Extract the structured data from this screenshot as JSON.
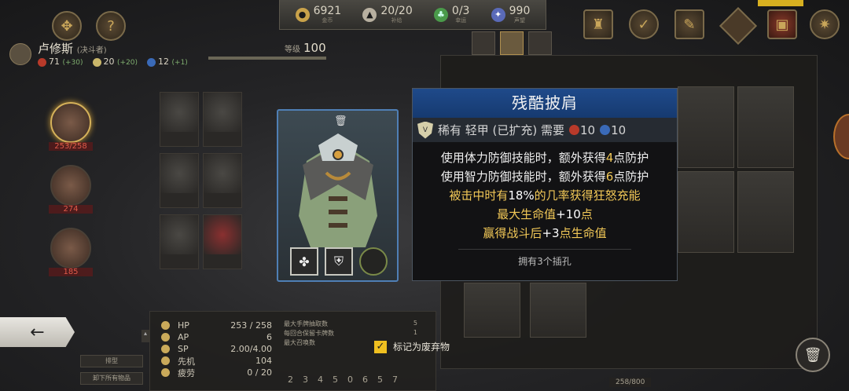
{
  "resources": [
    {
      "icon": "gold-coin-icon",
      "value": "6921",
      "label": "金币",
      "color": "#c9a24a"
    },
    {
      "icon": "provisions-icon",
      "value": "20/20",
      "label": "补给",
      "color": "#b8b0a0"
    },
    {
      "icon": "clover-icon",
      "value": "0/3",
      "label": "幸运",
      "color": "#4a9a4a"
    },
    {
      "icon": "reputation-icon",
      "value": "990",
      "label": "声望",
      "color": "#5a6ab8"
    }
  ],
  "character": {
    "name": "卢修斯",
    "class": "(决斗者)",
    "hp": "71",
    "hp_bonus": "(+30)",
    "armor": "20",
    "armor_bonus": "(+20)",
    "magic": "12",
    "magic_bonus": "(+1)",
    "level_label": "等级",
    "level": "100"
  },
  "party": [
    {
      "hp": "253/258"
    },
    {
      "hp": "274"
    },
    {
      "hp": "185"
    }
  ],
  "tooltip": {
    "title": "残酷披肩",
    "rarity_type": "稀有 轻甲 (已扩充) 需要",
    "req_str": "10",
    "req_int": "10",
    "line1_pre": "使用体力防御技能时，额外获得",
    "line1_num": "4",
    "line1_post": "点防护",
    "line2_pre": "使用智力防御技能时，额外获得",
    "line2_num": "6",
    "line2_post": "点防护",
    "line3_pre": "被击中时有",
    "line3_num": "18%",
    "line3_post": "的几率获得狂怒充能",
    "line4_pre": "最大生命值",
    "line4_num": "+10",
    "line4_post": "点",
    "line5_pre": "赢得战斗后",
    "line5_num": "+3",
    "line5_post": "点生命值",
    "sockets_text": "拥有3个插孔"
  },
  "stats": [
    {
      "key": "HP",
      "value": "253 / 258"
    },
    {
      "key": "AP",
      "value": "6"
    },
    {
      "key": "SP",
      "value": "2.00/4.00"
    },
    {
      "key": "先机",
      "value": "104"
    },
    {
      "key": "疲劳",
      "value": "0 / 20"
    }
  ],
  "right_stats": [
    {
      "key": "最大手牌抽取数",
      "value": "5"
    },
    {
      "key": "每回合保留卡牌数",
      "value": "1"
    },
    {
      "key": "最大召唤数",
      "value": ""
    }
  ],
  "skill_numbers": [
    "2",
    "3",
    "4",
    "5",
    "0",
    "6",
    "5",
    "7"
  ],
  "buttons": {
    "sort": "排型",
    "unequip_all": "卸下所有物品",
    "discard_label": "标记为废弃物",
    "discard_check": "✓",
    "back": "←"
  },
  "inventory_capacity": "258/800"
}
